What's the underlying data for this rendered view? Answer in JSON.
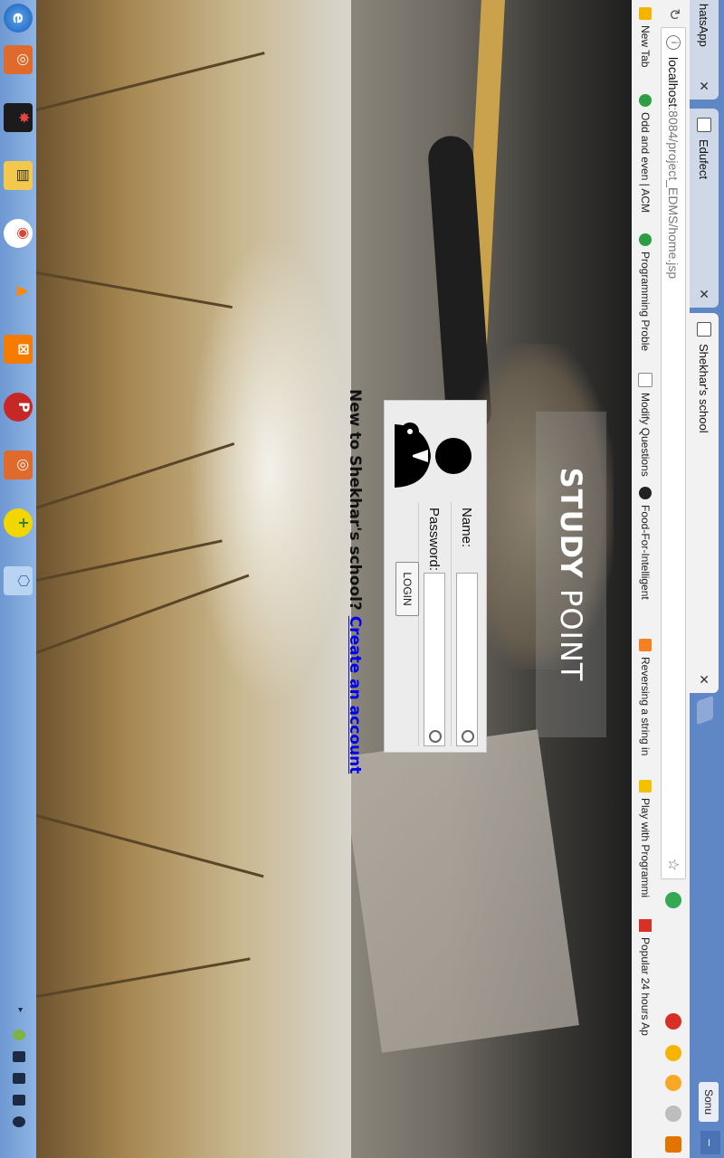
{
  "browser": {
    "tabs": [
      {
        "label": "hatsApp",
        "active": false
      },
      {
        "label": "Edufect",
        "active": false
      },
      {
        "label": "Shekhar's school",
        "active": true
      }
    ],
    "user_badge": "Sonu",
    "window_controls": {
      "minimize": "–"
    }
  },
  "address_bar": {
    "host": "localhost",
    "path": ":8084/project_EDMS/home.jsp",
    "info_glyph": "i"
  },
  "bookmarks": [
    {
      "label": "New Tab",
      "icon": "apps-icon",
      "color": "#f4b400"
    },
    {
      "label": "Odd and even | ACM",
      "icon": "hackerearth-icon",
      "color": "#2e9e44"
    },
    {
      "label": "Programming Proble",
      "icon": "hackerearth-icon",
      "color": "#2e9e44"
    },
    {
      "label": "Modify Questions",
      "icon": "page-icon",
      "color": "#888888"
    },
    {
      "label": "Food-For-Intelligent",
      "icon": "github-icon",
      "color": "#222222"
    },
    {
      "label": "Reversing a string in",
      "icon": "stackoverflow-icon",
      "color": "#f48024"
    },
    {
      "label": "Play with Programmi",
      "icon": "codechef-icon",
      "color": "#f2c200"
    },
    {
      "label": "Popular 24 hours Ap",
      "icon": "x-icon",
      "color": "#d93025"
    }
  ],
  "page": {
    "title_bold": "STUDY",
    "title_light": " POINT",
    "login": {
      "name_label": "Name:",
      "password_label": "Password:",
      "button_label": "LOGIN"
    },
    "signup_prompt": "New to Shekhar's school? ",
    "signup_link": "Create an account"
  },
  "colors": {
    "tab_strip": "#5f87c6",
    "link": "#0000ee",
    "taskbar": "#7aa3da"
  }
}
